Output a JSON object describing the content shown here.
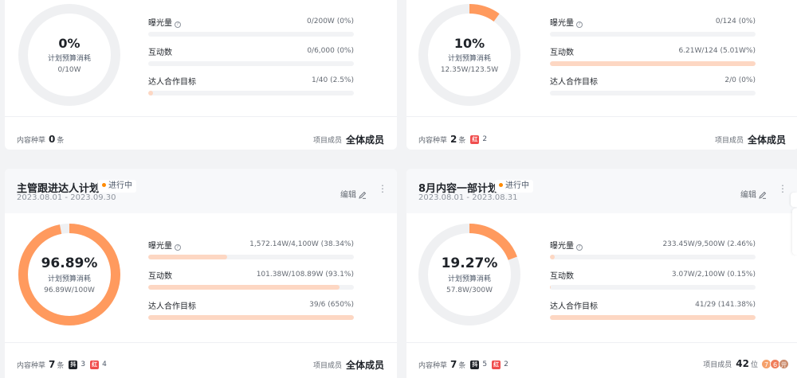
{
  "colors": {
    "accent": "#ff9a5e",
    "track": "#eff0f2",
    "bar_fill": "#fdd7c3",
    "status_dot": "#ff8a00"
  },
  "cards": [
    {
      "title": "",
      "date": "",
      "status": "",
      "ring": {
        "percent": "0%",
        "label": "计划预算消耗",
        "sub": "0/10W",
        "value": 0
      },
      "metrics": [
        {
          "name": "曝光量",
          "help_icon": "question-icon",
          "value": "0/200W  (0%)",
          "fill": 0
        },
        {
          "name": "互动数",
          "value": "0/6,000  (0%)",
          "fill": 0
        },
        {
          "name": "达人合作目标",
          "value": "1/40  (2.5%)",
          "fill": 0.025
        }
      ],
      "footer": {
        "content_label": "内容种草",
        "content_count": "0",
        "unit": "条",
        "platforms": [],
        "member_label": "项目成员",
        "member_value": "全体成员"
      }
    },
    {
      "title": "",
      "date": "",
      "status": "",
      "ring": {
        "percent": "10%",
        "label": "计划预算消耗",
        "sub": "12.35W/123.5W",
        "value": 0.1
      },
      "metrics": [
        {
          "name": "曝光量",
          "help_icon": "question-icon",
          "value": "0/124  (0%)",
          "fill": 0
        },
        {
          "name": "互动数",
          "value": "6.21W/124  (5.01W%)",
          "fill": 1
        },
        {
          "name": "达人合作目标",
          "value": "2/0  (0%)",
          "fill": 0
        }
      ],
      "footer": {
        "content_label": "内容种草",
        "content_count": "2",
        "unit": "条",
        "platforms": [
          {
            "icon": "xiaohongshu-icon",
            "glyph": "红",
            "count": "2"
          }
        ],
        "member_label": "项目成员",
        "member_value": "全体成员"
      }
    },
    {
      "title": "主管跟进达人计划",
      "date": "2023.08.01 - 2023.09.30",
      "status": "进行中",
      "edit": "编辑",
      "ring": {
        "percent": "96.89%",
        "label": "计划预算消耗",
        "sub": "96.89W/100W",
        "value": 0.9689
      },
      "metrics": [
        {
          "name": "曝光量",
          "help_icon": "question-icon",
          "value": "1,572.14W/4,100W  (38.34%)",
          "fill": 0.3834
        },
        {
          "name": "互动数",
          "value": "101.38W/108.89W  (93.1%)",
          "fill": 0.931
        },
        {
          "name": "达人合作目标",
          "value": "39/6  (650%)",
          "fill": 1
        }
      ],
      "footer": {
        "content_label": "内容种草",
        "content_count": "7",
        "unit": "条",
        "platforms": [
          {
            "icon": "douyin-icon",
            "glyph": "抖",
            "count": "3"
          },
          {
            "icon": "xiaohongshu-icon",
            "glyph": "红",
            "count": "4"
          }
        ],
        "member_label": "项目成员",
        "member_value": "全体成员"
      }
    },
    {
      "title": "8月内容一部计划",
      "date": "2023.08.01 - 2023.08.31",
      "status": "进行中",
      "edit": "编辑",
      "ring": {
        "percent": "19.27%",
        "label": "计划预算消耗",
        "sub": "57.8W/300W",
        "value": 0.1927
      },
      "metrics": [
        {
          "name": "曝光量",
          "help_icon": "question-icon",
          "value": "233.45W/9,500W  (2.46%)",
          "fill": 0.0246
        },
        {
          "name": "互动数",
          "value": "3.07W/2,100W  (0.15%)",
          "fill": 0.0015
        },
        {
          "name": "达人合作目标",
          "value": "41/29  (141.38%)",
          "fill": 1
        }
      ],
      "footer": {
        "content_label": "内容种草",
        "content_count": "7",
        "unit": "条",
        "platforms": [
          {
            "icon": "douyin-icon",
            "glyph": "抖",
            "count": "5"
          },
          {
            "icon": "xiaohongshu-icon",
            "glyph": "红",
            "count": "2"
          }
        ],
        "member_label": "项目成员",
        "member_count": "42",
        "member_unit": "位",
        "avatars": [
          {
            "glyph": "7",
            "color": "#f5a06b"
          },
          {
            "glyph": "6",
            "color": "#ef7d5a"
          },
          {
            "glyph": "亓",
            "color": "#c98a6b"
          }
        ]
      }
    }
  ]
}
